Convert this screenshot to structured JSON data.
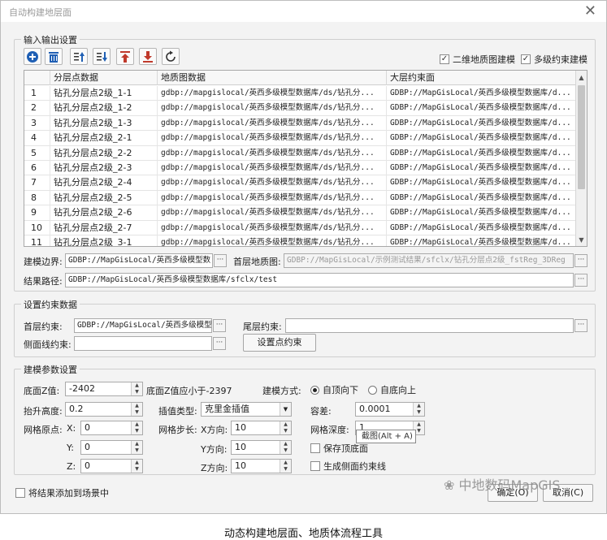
{
  "window": {
    "title": "自动构建地层面",
    "close_icon": "close-icon"
  },
  "io_group": {
    "legend": "输入输出设置",
    "toolbar_icons": [
      "add-icon",
      "delete-icon",
      "move-up-icon",
      "move-down-icon",
      "move-top-icon",
      "move-bottom-icon",
      "refresh-icon"
    ],
    "check_2d": "二维地质图建模",
    "check_multi": "多级约束建模",
    "check_2d_checked": true,
    "check_multi_checked": true,
    "table": {
      "columns": [
        "",
        "分层点数据",
        "地质图数据",
        "大层约束面"
      ],
      "rows": [
        [
          "1",
          "钻孔分层点2级_1-1",
          "gdbp://mapgislocal/英西多级模型数据库/ds/钻孔分...",
          "GDBP://MapGisLocal/英西多级模型数据库/d..."
        ],
        [
          "2",
          "钻孔分层点2级_1-2",
          "gdbp://mapgislocal/英西多级模型数据库/ds/钻孔分...",
          "GDBP://MapGisLocal/英西多级模型数据库/d..."
        ],
        [
          "3",
          "钻孔分层点2级_1-3",
          "gdbp://mapgislocal/英西多级模型数据库/ds/钻孔分...",
          "GDBP://MapGisLocal/英西多级模型数据库/d..."
        ],
        [
          "4",
          "钻孔分层点2级_2-1",
          "gdbp://mapgislocal/英西多级模型数据库/ds/钻孔分...",
          "GDBP://MapGisLocal/英西多级模型数据库/d..."
        ],
        [
          "5",
          "钻孔分层点2级_2-2",
          "gdbp://mapgislocal/英西多级模型数据库/ds/钻孔分...",
          "GDBP://MapGisLocal/英西多级模型数据库/d..."
        ],
        [
          "6",
          "钻孔分层点2级_2-3",
          "gdbp://mapgislocal/英西多级模型数据库/ds/钻孔分...",
          "GDBP://MapGisLocal/英西多级模型数据库/d..."
        ],
        [
          "7",
          "钻孔分层点2级_2-4",
          "gdbp://mapgislocal/英西多级模型数据库/ds/钻孔分...",
          "GDBP://MapGisLocal/英西多级模型数据库/d..."
        ],
        [
          "8",
          "钻孔分层点2级_2-5",
          "gdbp://mapgislocal/英西多级模型数据库/ds/钻孔分...",
          "GDBP://MapGisLocal/英西多级模型数据库/d..."
        ],
        [
          "9",
          "钻孔分层点2级_2-6",
          "gdbp://mapgislocal/英西多级模型数据库/ds/钻孔分...",
          "GDBP://MapGisLocal/英西多级模型数据库/d..."
        ],
        [
          "10",
          "钻孔分层点2级_2-7",
          "gdbp://mapgislocal/英西多级模型数据库/ds/钻孔分...",
          "GDBP://MapGisLocal/英西多级模型数据库/d..."
        ],
        [
          "11",
          "钻孔分层点2级_3-1",
          "gdbp://mapgislocal/英西多级模型数据库/ds/钻孔分...",
          "GDBP://MapGisLocal/英西多级模型数据库/d..."
        ]
      ]
    },
    "boundary_label": "建模边界:",
    "boundary_value": "GDBP://MapGisLocal/英西多级模型数",
    "top_geomap_label": "首层地质图:",
    "top_geomap_value": "GDBP://MapGisLocal/示例测试结果/sfclx/钻孔分层点2级_fstReg_3DReg",
    "result_label": "结果路径:",
    "result_value": "GDBP://MapGisLocal/英西多级模型数据库/sfclx/test",
    "browse_label": "···"
  },
  "constraint_group": {
    "legend": "设置约束数据",
    "top_label": "首层约束:",
    "top_value": "GDBP://MapGisLocal/英西多级模型",
    "tail_label": "尾层约束:",
    "tail_value": "",
    "side_label": "侧面线约束:",
    "side_value": "",
    "set_point_button": "设置点约束"
  },
  "params_group": {
    "legend": "建模参数设置",
    "bottom_z_label": "底面Z值:",
    "bottom_z_value": "-2402",
    "bottom_z_hint": "底面Z值应小于-2397",
    "method_label": "建模方式:",
    "method_top_down": "自顶向下",
    "method_bottom_up": "自底向上",
    "method_selected": "top-down",
    "lift_label": "抬升高度:",
    "lift_value": "0.2",
    "interp_label": "插值类型:",
    "interp_value": "克里金插值",
    "tolerance_label": "容差:",
    "tolerance_value": "0.0001",
    "origin_label": "网格原点:",
    "x_label": "X:",
    "x_value": "0",
    "y_label": "Y:",
    "y_value": "0",
    "z_label": "Z:",
    "z_value": "0",
    "step_label": "网格步长:",
    "step_x_label": "X方向:",
    "step_x_value": "10",
    "step_y_label": "Y方向:",
    "step_y_value": "10",
    "step_z_label": "Z方向:",
    "step_z_value": "10",
    "depth_label": "网格深度:",
    "depth_value": "1",
    "keep_bottom": "保存顶底面",
    "gen_side": "生成侧面约束线",
    "tooltip": "截图(Alt + A)"
  },
  "footer": {
    "add_to_scene": "将结果添加到场景中",
    "ok_button": "确定(O)",
    "cancel_button": "取消(C)",
    "watermark": "中地数码MapGIS"
  },
  "caption": "动态构建地层面、地质体流程工具"
}
